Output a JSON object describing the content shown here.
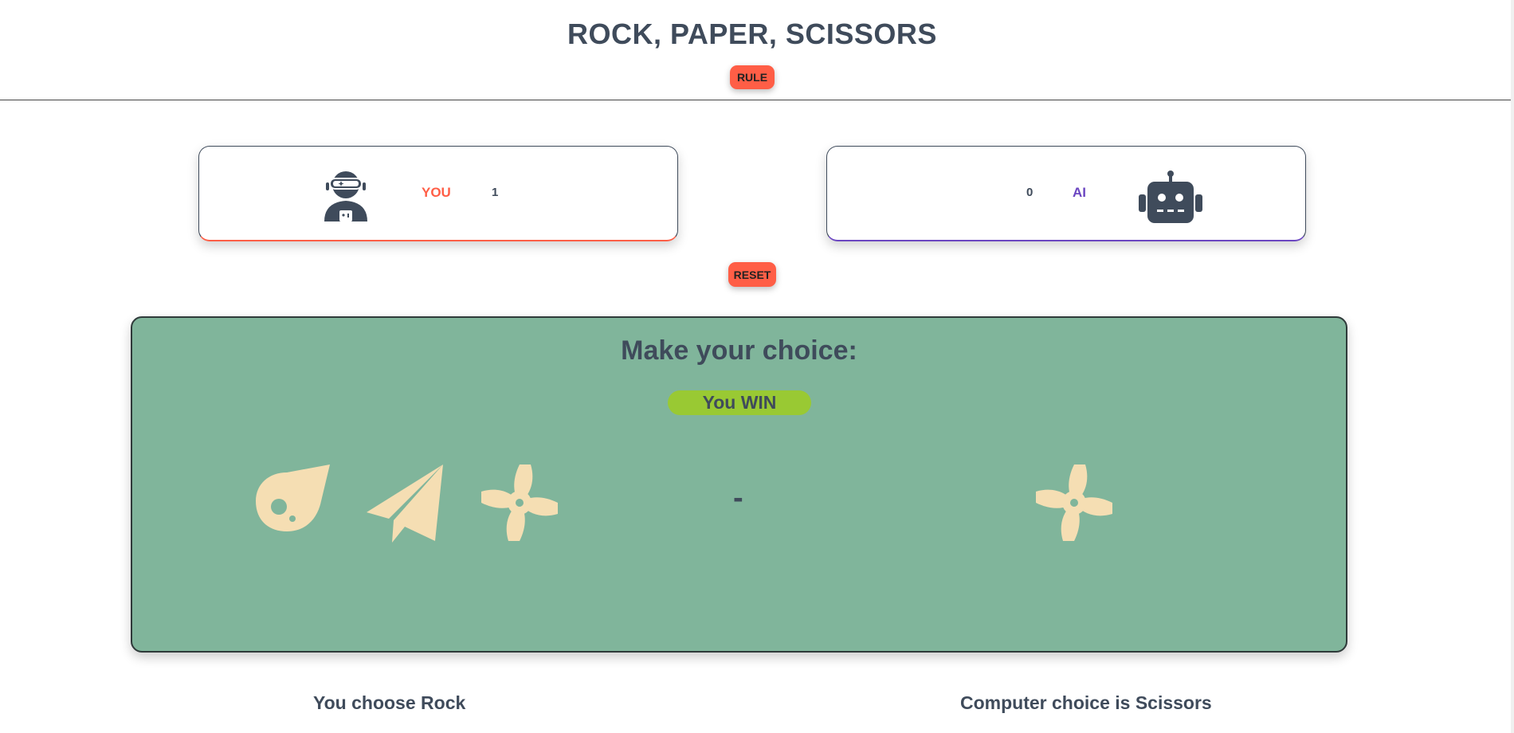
{
  "header": {
    "title": "ROCK, PAPER, SCISSORS",
    "rule_label": "RULE"
  },
  "scoreboard": {
    "you": {
      "label": "YOU",
      "score": "1",
      "icon": "astronaut-icon",
      "accent": "#ff5e46"
    },
    "ai": {
      "label": "AI",
      "score": "0",
      "icon": "robot-icon",
      "accent": "#6b46c1"
    },
    "reset_label": "RESET"
  },
  "board": {
    "title": "Make your choice:",
    "result": "You WIN",
    "separator": "-",
    "choices": [
      {
        "name": "Rock",
        "icon": "meteor-icon"
      },
      {
        "name": "Paper",
        "icon": "paper-plane-icon"
      },
      {
        "name": "Scissors",
        "icon": "pinwheel-icon"
      }
    ],
    "computer_choice_icon": "pinwheel-icon"
  },
  "footer": {
    "you_choice_text": "You choose Rock",
    "computer_choice_text": "Computer choice is Scissors"
  },
  "colors": {
    "board_bg": "#80b59b",
    "icon_fill": "#f5deb3",
    "button": "#ff5e46",
    "result_bg": "#99c933",
    "text": "#3f4b5b"
  }
}
